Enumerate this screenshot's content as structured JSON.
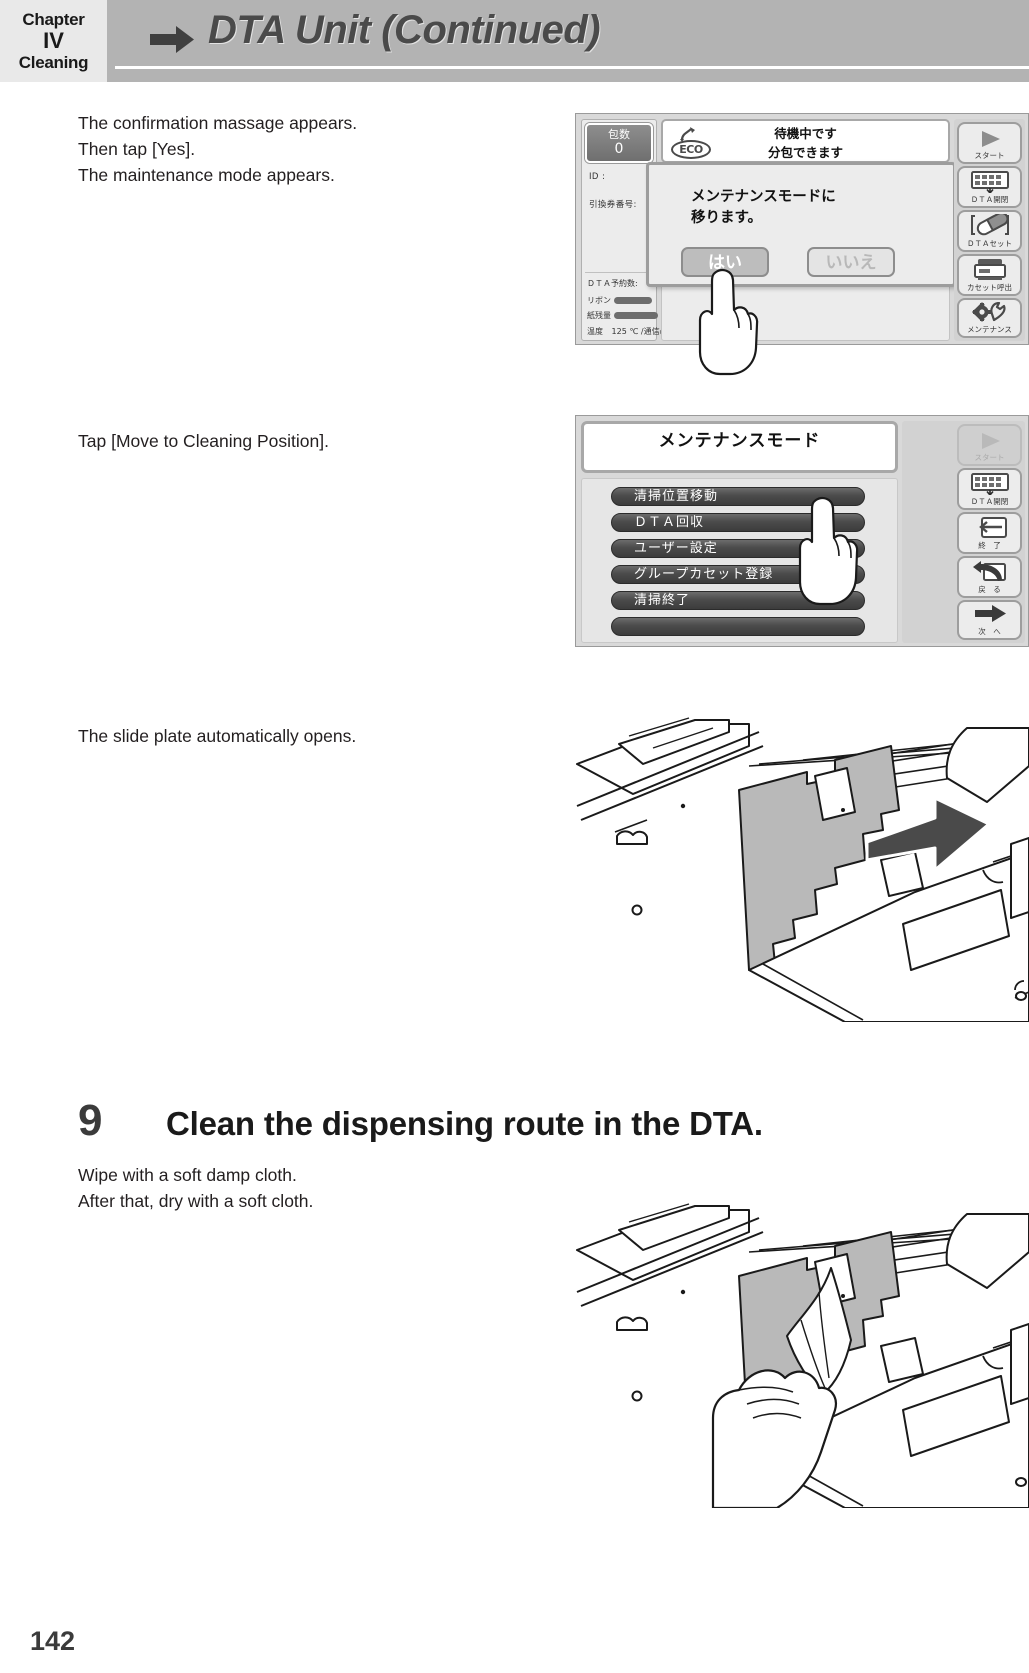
{
  "header": {
    "chapter_label": "Chapter",
    "chapter_number": "IV",
    "chapter_topic": "Cleaning",
    "title": "DTA Unit (Continued)",
    "arrow_icon": "right-arrow-icon"
  },
  "body": {
    "para1_line1": "The confirmation massage appears.",
    "para1_line2": "Then tap [Yes].",
    "para1_line3": "The maintenance mode appears.",
    "para2_line1": "Tap [Move to Cleaning Position].",
    "para3_line1": "The slide plate automatically opens.",
    "para4_line1": "Wipe with a soft damp cloth.",
    "para4_line2": "After that, dry with a soft cloth."
  },
  "step": {
    "number": "9",
    "title": "Clean the dispensing route in the DTA."
  },
  "page_number": "142",
  "screen1": {
    "count_label": "包数",
    "count_value": "0",
    "id_label": "ID :",
    "ticket_label": "引換券番号:",
    "dta_reserved_label": "ＤＴＡ予約数:",
    "ribbon_label": "リボン",
    "paper_label": "紙残量",
    "temp_label": "温度",
    "temp_value": "125 ℃",
    "comm_label": "/通信○",
    "status_line1": "待機中です",
    "status_line2": "分包できます",
    "eco_label": "ECO",
    "dialog_line1": "メンテナンスモードに",
    "dialog_line2": "移ります。",
    "dialog_yes": "はい",
    "dialog_no": "いいえ",
    "side_buttons": [
      {
        "label": "スタート",
        "icon": "play-triangle-icon",
        "disabled": false
      },
      {
        "label": "ＤＴＡ開閉",
        "icon": "dta-tray-icon",
        "disabled": false
      },
      {
        "label": "ＤＴＡセット",
        "icon": "capsule-icon",
        "disabled": false
      },
      {
        "label": "カセット呼出",
        "icon": "cassette-icon",
        "disabled": false
      },
      {
        "label": "メンテナンス",
        "icon": "gear-wrench-icon",
        "disabled": false
      }
    ]
  },
  "screen2": {
    "title": "メンテナンスモード",
    "menu_items": [
      "清掃位置移動",
      "ＤＴＡ回収",
      "ユーザー設定",
      "グループカセット登録",
      "清掃終了",
      ""
    ],
    "side_buttons": [
      {
        "label": "スタート",
        "icon": "play-triangle-icon",
        "disabled": true
      },
      {
        "label": "ＤＴＡ開閉",
        "icon": "dta-tray-icon",
        "disabled": false
      },
      {
        "label": "終　了",
        "icon": "exit-arrow-icon",
        "disabled": false
      },
      {
        "label": "戻　る",
        "icon": "back-arrow-icon",
        "disabled": false
      },
      {
        "label": "次　へ",
        "icon": "next-arrow-icon",
        "disabled": false
      }
    ]
  },
  "figures": {
    "fig1_name": "slide-plate-open-illustration",
    "fig2_name": "wipe-dispensing-route-illustration"
  }
}
